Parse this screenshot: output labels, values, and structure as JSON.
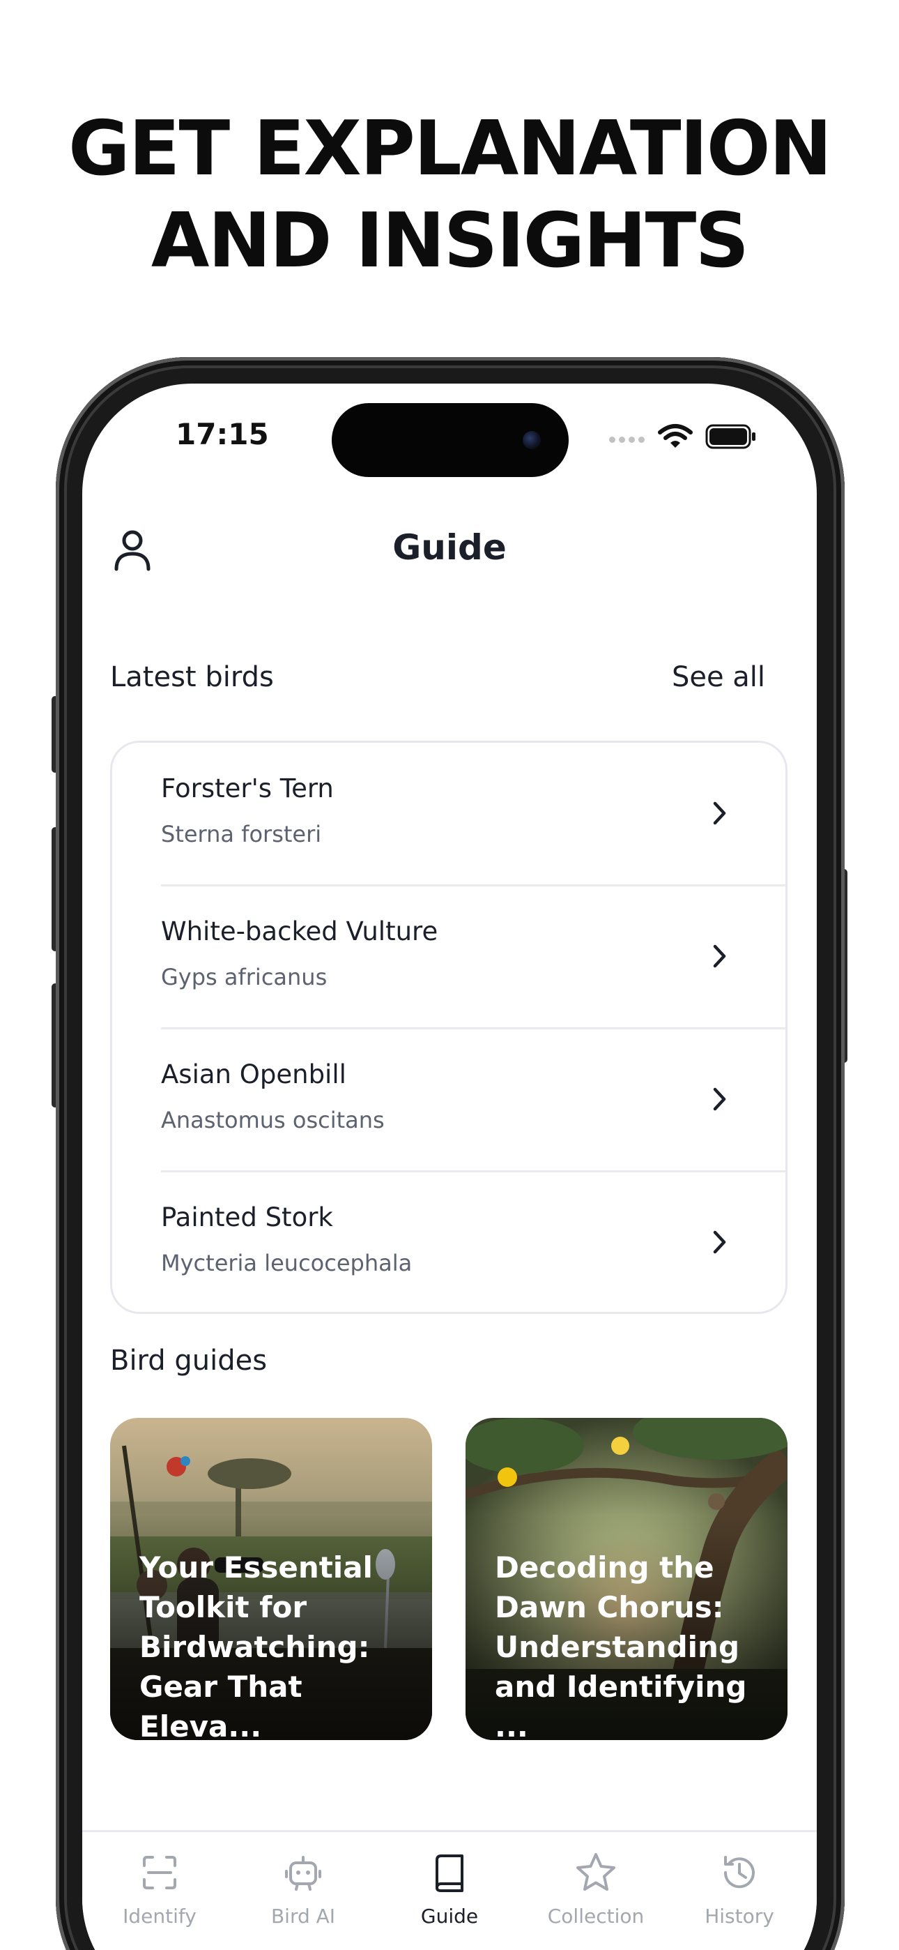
{
  "headline": {
    "line1": "GET EXPLANATION",
    "line2": "AND INSIGHTS"
  },
  "status_bar": {
    "time": "17:15"
  },
  "header": {
    "title": "Guide",
    "profile_icon": "person-icon"
  },
  "latest": {
    "title": "Latest birds",
    "see_all": "See all",
    "items": [
      {
        "name": "Forster's Tern",
        "scientific": "Sterna forsteri"
      },
      {
        "name": "White-backed Vulture",
        "scientific": "Gyps africanus"
      },
      {
        "name": "Asian Openbill",
        "scientific": "Anastomus oscitans"
      },
      {
        "name": "Painted Stork",
        "scientific": "Mycteria leucocephala"
      }
    ]
  },
  "guides": {
    "title": "Bird guides",
    "cards": [
      {
        "title": "Your Essential\nToolkit for\nBirdwatching:\nGear That Eleva..."
      },
      {
        "title": "Decoding the\nDawn Chorus:\nUnderstanding\nand Identifying ..."
      }
    ]
  },
  "tabs": [
    {
      "label": "Identify",
      "icon": "scan-icon",
      "active": false
    },
    {
      "label": "Bird AI",
      "icon": "robot-icon",
      "active": false
    },
    {
      "label": "Guide",
      "icon": "book-icon",
      "active": true
    },
    {
      "label": "Collection",
      "icon": "star-icon",
      "active": false
    },
    {
      "label": "History",
      "icon": "history-icon",
      "active": false
    }
  ],
  "colors": {
    "text_primary": "#1b1f2a",
    "text_secondary": "#5d6270",
    "tab_inactive": "#a3a7b0",
    "border": "#e6e8ee"
  }
}
